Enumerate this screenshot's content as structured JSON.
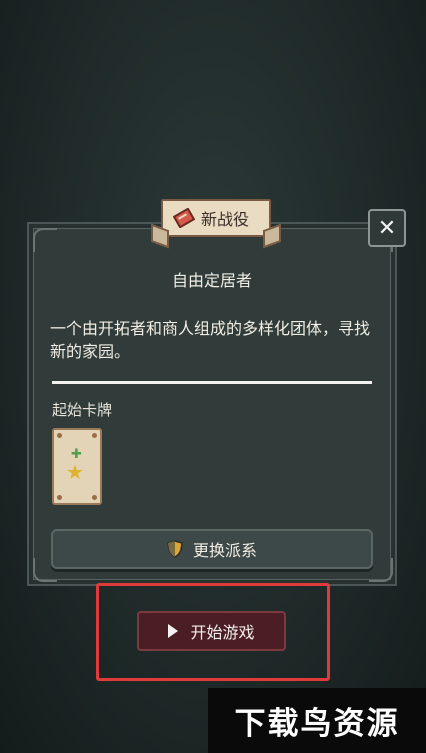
{
  "banner": {
    "label": "新战役",
    "icon": "scroll-icon"
  },
  "close": {
    "label": "✕"
  },
  "faction": {
    "title": "自由定居者",
    "description": "一个由开拓者和商人组成的多样化团体，寻找新的家园。"
  },
  "cards": {
    "label": "起始卡牌"
  },
  "buttons": {
    "change_faction": "更换派系",
    "start_game": "开始游戏"
  },
  "watermark": "下载鸟资源",
  "colors": {
    "accent_red": "#e23a3a",
    "start_button": "#4a1e24",
    "panel": "#303b3a"
  }
}
